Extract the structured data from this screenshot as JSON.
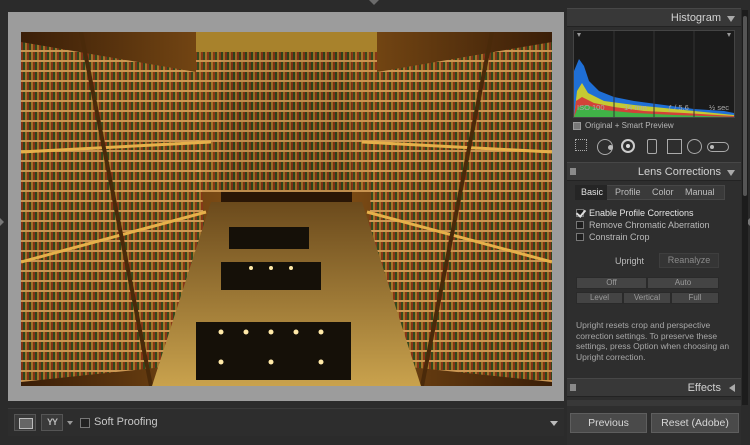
{
  "histogram": {
    "title": "Histogram",
    "iso": "ISO 100",
    "focal_length": "14 mm",
    "aperture": "ƒ / 5.6",
    "shutter": "½ sec",
    "preview_status": "Original + Smart Preview"
  },
  "tools": [
    "grid-overlay-icon",
    "crop-icon",
    "spot-removal-icon",
    "red-eye-icon",
    "graduated-filter-icon",
    "radial-filter-icon",
    "adjustment-brush-icon"
  ],
  "lens_corrections": {
    "title": "Lens Corrections",
    "tabs": [
      "Basic",
      "Profile",
      "Color",
      "Manual"
    ],
    "active_tab": "Basic",
    "options": [
      {
        "label": "Enable Profile Corrections",
        "checked": true
      },
      {
        "label": "Remove Chromatic Aberration",
        "checked": false
      },
      {
        "label": "Constrain Crop",
        "checked": false
      }
    ],
    "upright_label": "Upright",
    "reanalyze_label": "Reanalyze",
    "upright_buttons": [
      "Off",
      "Auto",
      "Level",
      "Vertical",
      "Full"
    ],
    "description": "Upright resets crop and perspective correction settings. To preserve these settings, press Option when choosing an Upright correction."
  },
  "effects": {
    "title": "Effects"
  },
  "toolbar": {
    "compare_glyph": "YY",
    "soft_proofing_label": "Soft Proofing"
  },
  "buttons": {
    "previous": "Previous",
    "reset": "Reset (Adobe)"
  },
  "colors": {
    "panel_bg": "#2e2e2e",
    "preview_bg": "#9c9c9c",
    "accent_text": "#d2d2d2"
  }
}
